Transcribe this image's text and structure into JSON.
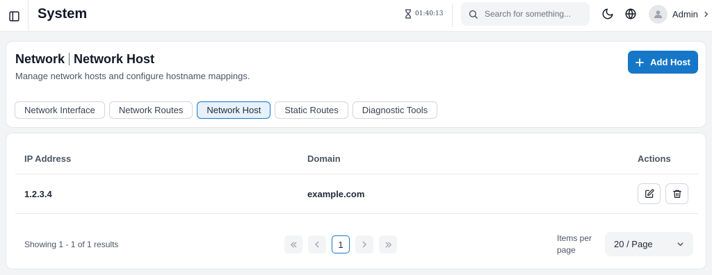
{
  "topbar": {
    "title": "System",
    "timer": "01:40:13",
    "search_placeholder": "Search for something...",
    "user_name": "Admin"
  },
  "header": {
    "section": "Network",
    "title": "Network Host",
    "description": "Manage network hosts and configure hostname mappings.",
    "add_button_label": "Add Host"
  },
  "tabs": [
    {
      "label": "Network Interface",
      "active": false
    },
    {
      "label": "Network Routes",
      "active": false
    },
    {
      "label": "Network Host",
      "active": true
    },
    {
      "label": "Static Routes",
      "active": false
    },
    {
      "label": "Diagnostic Tools",
      "active": false
    }
  ],
  "table": {
    "columns": [
      "IP Address",
      "Domain",
      "Actions"
    ],
    "rows": [
      {
        "ip": "1.2.3.4",
        "domain": "example.com"
      }
    ]
  },
  "pagination": {
    "summary": "Showing 1 - 1 of 1 results",
    "current_page": "1",
    "items_per_page_label": "Items per page",
    "page_size": "20 / Page"
  },
  "colors": {
    "accent": "#1677c8",
    "active_tab_bg": "#e6f1fb"
  }
}
